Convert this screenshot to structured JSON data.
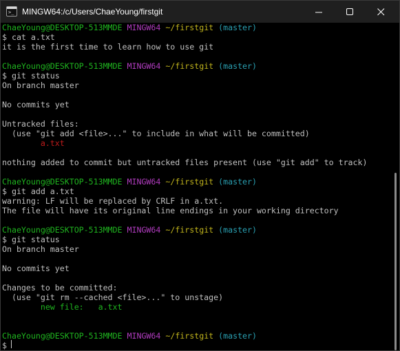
{
  "window": {
    "title": "MINGW64:/c/Users/ChaeYoung/firstgit",
    "app_icon": "git-bash-terminal-icon",
    "controls": [
      "minimize-icon",
      "maximize-icon",
      "close-icon"
    ]
  },
  "terminal": {
    "prompt": {
      "user_host": "ChaeYoung@DESKTOP-513MMDE",
      "system": "MINGW64",
      "path": "~/firstgit",
      "branch": "(master)",
      "symbol": "$"
    },
    "lines": {
      "l02": "$ cat a.txt",
      "l03": "it is the first time to learn how to use git",
      "l06": "$ git status",
      "l07": "On branch master",
      "l09": "No commits yet",
      "l11": "Untracked files:",
      "l12": "  (use \"git add <file>...\" to include in what will be committed)",
      "l13": "        a.txt",
      "l15": "nothing added to commit but untracked files present (use \"git add\" to track)",
      "l18": "$ git add a.txt",
      "l19": "warning: LF will be replaced by CRLF in a.txt.",
      "l20": "The file will have its original line endings in your working directory",
      "l23": "$ git status",
      "l24": "On branch master",
      "l26": "No commits yet",
      "l28": "Changes to be committed:",
      "l29": "  (use \"git rm --cached <file>...\" to unstage)",
      "l30": "        new file:   a.txt",
      "l34": "$ "
    }
  },
  "colors": {
    "user_host": "#1fb41f",
    "system": "#b13cbf",
    "path": "#c1b41c",
    "branch": "#2aa1b3",
    "untracked": "#c11b1b",
    "staged": "#1fb41f",
    "text": "#c0c0c0",
    "background": "#000000",
    "titlebar": "#1f1f1f"
  }
}
